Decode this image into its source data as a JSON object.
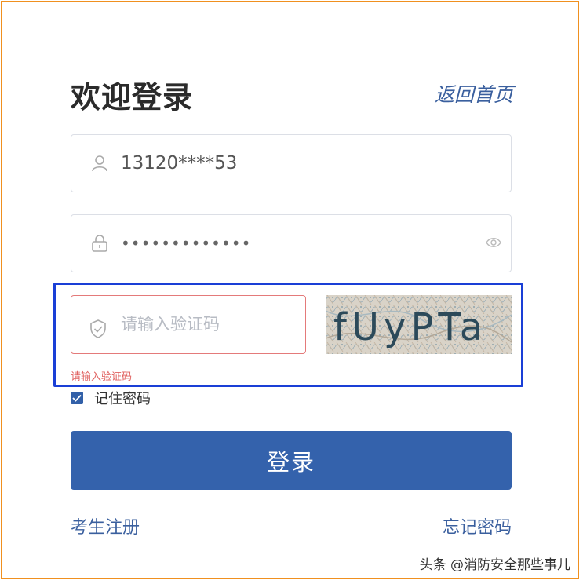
{
  "header": {
    "title": "欢迎登录",
    "back_link": "返回首页"
  },
  "username": {
    "value": "13120****53",
    "icon": "user-icon"
  },
  "password": {
    "value": "•••••••••••••",
    "icon": "lock-icon",
    "toggle_icon": "eye-icon"
  },
  "captcha": {
    "placeholder": "请输入验证码",
    "icon": "shield-check-icon",
    "error": "请输入验证码",
    "image_text": "fUyPTa"
  },
  "remember": {
    "label": "记住密码",
    "checked": true
  },
  "login_button": "登录",
  "footer": {
    "register": "考生注册",
    "forgot": "忘记密码"
  },
  "watermark": "头条 @消防安全那些事儿",
  "colors": {
    "primary": "#3462ac",
    "error": "#e0615f",
    "link": "#3a5f9e",
    "frame": "#f0901f",
    "highlight": "#1a3fd6"
  }
}
